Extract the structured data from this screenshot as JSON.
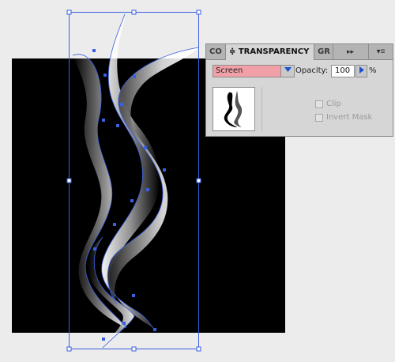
{
  "panel": {
    "tabs": [
      {
        "label": "CO",
        "active": false
      },
      {
        "label": "≑ TRANSPARENCY",
        "active": true
      },
      {
        "label": "GR",
        "active": false
      }
    ],
    "collapse_glyph": "▸▸",
    "menu_glyph": "▾≡",
    "blend_mode": "Screen",
    "opacity_label": "Opacity:",
    "opacity_value": "100",
    "opacity_unit": "%",
    "clip_label": "Clip",
    "invert_mask_label": "Invert Mask",
    "clip_checked": false,
    "invert_mask_checked": false
  },
  "colors": {
    "canvas_bg": "#000000",
    "selection": "#3a5fe0",
    "blend_highlight": "#f1a0a8"
  },
  "icons": [
    "dropdown-arrow-icon",
    "stepper-arrow-icon",
    "panel-menu-icon",
    "collapse-icon"
  ]
}
